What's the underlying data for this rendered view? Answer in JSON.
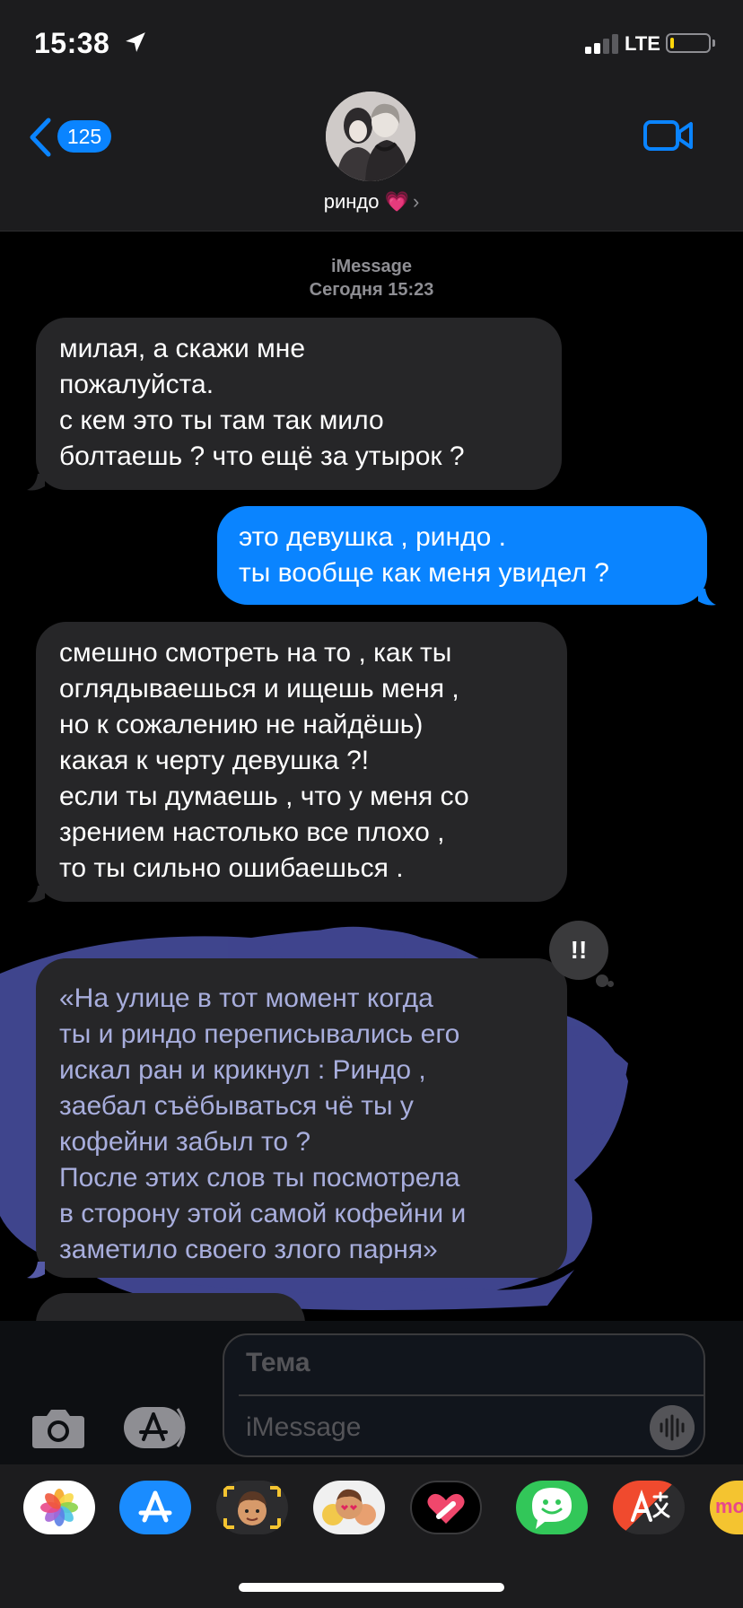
{
  "status_bar": {
    "time": "15:38",
    "network": "LTE"
  },
  "nav": {
    "back_count": "125",
    "contact_name": "риндо 💗",
    "contact_chevron": "›"
  },
  "thread": {
    "service": "iMessage",
    "timestamp": "Сегодня 15:23"
  },
  "messages": [
    {
      "direction": "incoming",
      "lines": [
        "милая, а скажи мне",
        "пожалуйста.",
        "с кем это ты там так мило",
        "болтаешь ? что ещё за утырок ?"
      ]
    },
    {
      "direction": "outgoing",
      "lines": [
        "это девушка , риндо .",
        "ты вообще как меня увидел ?"
      ]
    },
    {
      "direction": "incoming",
      "lines": [
        "смешно смотреть на то , как ты",
        "оглядываешься и ищешь меня ,",
        "но к сожалению не найдёшь)",
        "какая к черту девушка ?!",
        "если ты думаешь , что у меня со",
        "зрением настолько все плохо ,",
        "то ты сильно ошибаешься ."
      ]
    },
    {
      "direction": "incoming",
      "tapback": "!!",
      "lines": [
        "«На улице в тот момент когда",
        "ты и риндо переписывались его",
        "искал ран и крикнул : Риндо ,",
        "заебал съёбываться чё ты у",
        "кофейни забыл то ?",
        "После этих слов ты посмотрела",
        "в сторону этой самой кофейни и",
        "заметило своего злого парня»"
      ]
    }
  ],
  "composer": {
    "subject_placeholder": "Тема",
    "message_placeholder": "iMessage"
  },
  "app_drawer": {
    "apps": [
      {
        "name": "photos-app-icon"
      },
      {
        "name": "app-store-app-icon"
      },
      {
        "name": "memoji-app-icon"
      },
      {
        "name": "memoji-stickers-app-icon"
      },
      {
        "name": "digital-touch-app-icon"
      },
      {
        "name": "stickers-app-icon"
      },
      {
        "name": "translate-app-icon"
      },
      {
        "name": "music-app-icon",
        "label": "mo"
      }
    ]
  },
  "colors": {
    "outgoing_bubble": "#0a84ff",
    "incoming_bubble": "#262628",
    "badge": "#0a84ff",
    "background": "#000000"
  }
}
